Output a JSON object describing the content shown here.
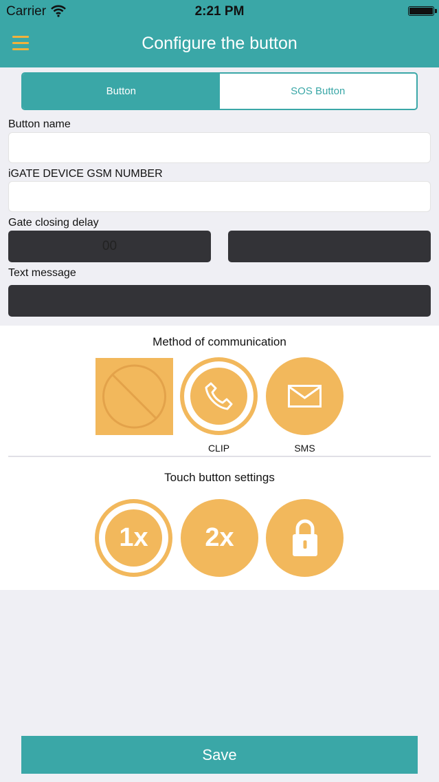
{
  "status_bar": {
    "carrier": "Carrier",
    "time": "2:21 PM"
  },
  "header": {
    "title": "Configure the button",
    "menu_icon": "hamburger-icon"
  },
  "tabs": [
    {
      "label": "Button",
      "active": true
    },
    {
      "label": "SOS Button",
      "active": false
    }
  ],
  "form": {
    "button_name_label": "Button name",
    "button_name_value": "",
    "gsm_label": "iGATE DEVICE GSM NUMBER",
    "gsm_value": "",
    "delay_label": "Gate closing delay",
    "delay_value_1": "00",
    "delay_value_2": "",
    "text_message_label": "Text message",
    "text_message_value": ""
  },
  "communication": {
    "title": "Method of communication",
    "options": [
      {
        "label": "",
        "icon": "none-icon",
        "selected": false
      },
      {
        "label": "CLIP",
        "icon": "phone-icon",
        "selected": true
      },
      {
        "label": "SMS",
        "icon": "envelope-icon",
        "selected": false
      }
    ]
  },
  "touch": {
    "title": "Touch button settings",
    "options": [
      {
        "label": "1x",
        "selected": true
      },
      {
        "label": "2x",
        "selected": false
      },
      {
        "label": "",
        "icon": "lock-icon",
        "selected": false
      }
    ]
  },
  "save_label": "Save",
  "colors": {
    "accent": "#3aa7a7",
    "option": "#f2b85c",
    "menu": "#f2b23b"
  }
}
